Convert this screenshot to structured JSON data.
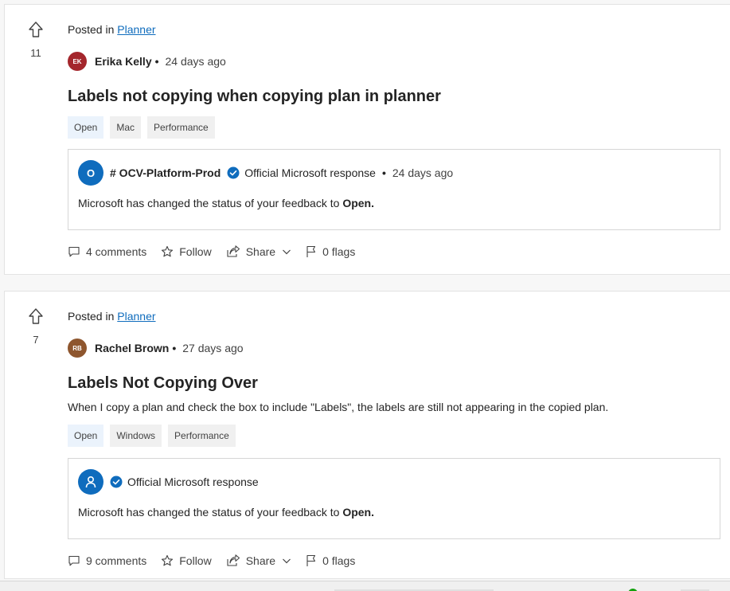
{
  "posts": [
    {
      "votes": "11",
      "posted_prefix": "Posted in",
      "forum": "Planner",
      "author_initials": "EK",
      "author": "Erika Kelly",
      "time": "24 days ago",
      "title": "Labels not copying when copying plan in planner",
      "description": "",
      "tags": [
        "Open",
        "Mac",
        "Performance"
      ],
      "response": {
        "avatar_letter": "O",
        "responder": "# OCV-Platform-Prod",
        "label": "Official Microsoft response",
        "time": "24 days ago",
        "body_prefix": "Microsoft has changed the status of your feedback to",
        "body_status": "Open."
      },
      "actions": {
        "comments": "4 comments",
        "follow": "Follow",
        "share": "Share",
        "flags": "0 flags"
      }
    },
    {
      "votes": "7",
      "posted_prefix": "Posted in",
      "forum": "Planner",
      "author_initials": "RB",
      "author": "Rachel Brown",
      "time": "27 days ago",
      "title": "Labels Not Copying Over",
      "description": "When I copy a plan and check the box to include \"Labels\", the labels are still not appearing in the copied plan.",
      "tags": [
        "Open",
        "Windows",
        "Performance"
      ],
      "response": {
        "responder": "",
        "label": "Official Microsoft response",
        "time": "",
        "body_prefix": "Microsoft has changed the status of your feedback to",
        "body_status": "Open."
      },
      "actions": {
        "comments": "9 comments",
        "follow": "Follow",
        "share": "Share",
        "flags": "0 flags"
      }
    }
  ],
  "icons": {
    "upvote": "arrow-up-outline-icon",
    "comment": "comment-icon",
    "follow": "star-icon",
    "share": "share-icon",
    "chevron": "chevron-down-icon",
    "flag": "flag-icon",
    "verified": "verified-check-icon",
    "person": "person-icon"
  },
  "colors": {
    "link": "#0f6cbd",
    "status_tag_bg": "#ebf3fc",
    "tag_bg": "#f0f0f0",
    "avatar_ek": "#a4262c",
    "avatar_rb": "#8e562e",
    "ms_blue": "#0f6cbd"
  }
}
